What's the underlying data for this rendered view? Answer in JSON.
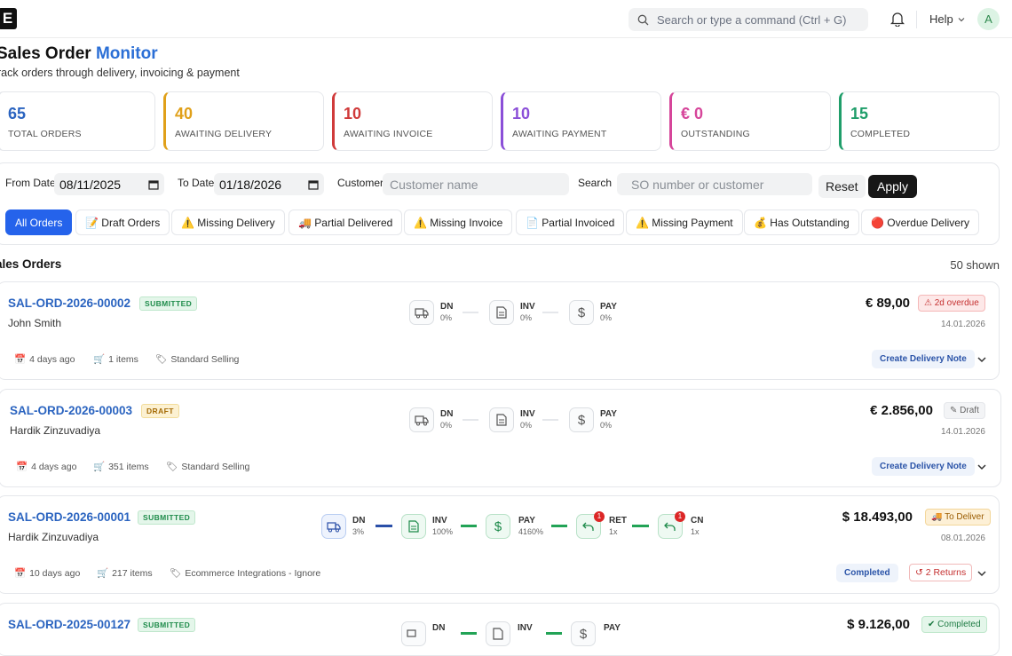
{
  "topbar": {
    "logo": "E",
    "search_placeholder": "Search or type a command (Ctrl + G)",
    "help": "Help",
    "avatar": "A"
  },
  "header": {
    "title_part1": "Sales Order",
    "title_part2": "Monitor",
    "subtitle": "rack orders through delivery, invoicing & payment"
  },
  "stats": [
    {
      "value": "65",
      "label": "TOTAL ORDERS",
      "color": "#2b64c0"
    },
    {
      "value": "40",
      "label": "AWAITING DELIVERY",
      "color": "#e0a019"
    },
    {
      "value": "10",
      "label": "AWAITING INVOICE",
      "color": "#d03a3a"
    },
    {
      "value": "10",
      "label": "AWAITING PAYMENT",
      "color": "#8b4fd8"
    },
    {
      "value": "€ 0",
      "label": "OUTSTANDING",
      "color": "#d6459a"
    },
    {
      "value": "15",
      "label": "COMPLETED",
      "color": "#1f9e6a"
    }
  ],
  "filters": {
    "from_label": "From Date",
    "from_value": "08/11/2025",
    "to_label": "To Date",
    "to_value": "01/18/2026",
    "customer_label": "Customer",
    "customer_placeholder": "Customer name",
    "search_label": "Search",
    "search_placeholder": "SO number or customer",
    "reset": "Reset",
    "apply": "Apply"
  },
  "chips": [
    "All Orders",
    "📝 Draft Orders",
    "⚠️ Missing Delivery",
    "🚚 Partial Delivered",
    "⚠️ Missing Invoice",
    "📄 Partial Invoiced",
    "⚠️ Missing Payment",
    "💰 Has Outstanding",
    "🔴 Overdue Delivery"
  ],
  "list": {
    "title": "ales Orders",
    "shown": "50 shown"
  },
  "orders": [
    {
      "id": "SAL-ORD-2026-00002",
      "status": "SUBMITTED",
      "customer": "John Smith",
      "steps": [
        {
          "label": "DN",
          "pct": "0%"
        },
        {
          "label": "INV",
          "pct": "0%"
        },
        {
          "label": "PAY",
          "pct": "0%"
        }
      ],
      "amount": "€ 89,00",
      "pill": "2d overdue",
      "date": "14.01.2026",
      "age": "4 days ago",
      "items": "1 items",
      "type": "Standard Selling",
      "action": "Create Delivery Note"
    },
    {
      "id": "SAL-ORD-2026-00003",
      "status": "DRAFT",
      "customer": "Hardik Zinzuvadiya",
      "steps": [
        {
          "label": "DN",
          "pct": "0%"
        },
        {
          "label": "INV",
          "pct": "0%"
        },
        {
          "label": "PAY",
          "pct": "0%"
        }
      ],
      "amount": "€ 2.856,00",
      "pill": "Draft",
      "date": "14.01.2026",
      "age": "4 days ago",
      "items": "351 items",
      "type": "Standard Selling",
      "action": "Create Delivery Note"
    },
    {
      "id": "SAL-ORD-2026-00001",
      "status": "SUBMITTED",
      "customer": "Hardik Zinzuvadiya",
      "steps": [
        {
          "label": "DN",
          "pct": "3%"
        },
        {
          "label": "INV",
          "pct": "100%"
        },
        {
          "label": "PAY",
          "pct": "4160%"
        },
        {
          "label": "RET",
          "pct": "1x",
          "count": "1"
        },
        {
          "label": "CN",
          "pct": "1x",
          "count": "1"
        }
      ],
      "amount": "$ 18.493,00",
      "pill": "To Deliver",
      "date": "08.01.2026",
      "age": "10 days ago",
      "items": "217 items",
      "type": "Ecommerce Integrations - Ignore",
      "action": "Completed",
      "returns": "2 Returns"
    },
    {
      "id": "SAL-ORD-2025-00127",
      "status": "SUBMITTED",
      "steps": [
        {
          "label": "DN"
        },
        {
          "label": "INV"
        },
        {
          "label": "PAY"
        }
      ],
      "amount": "$ 9.126,00",
      "pill": "Completed"
    }
  ]
}
